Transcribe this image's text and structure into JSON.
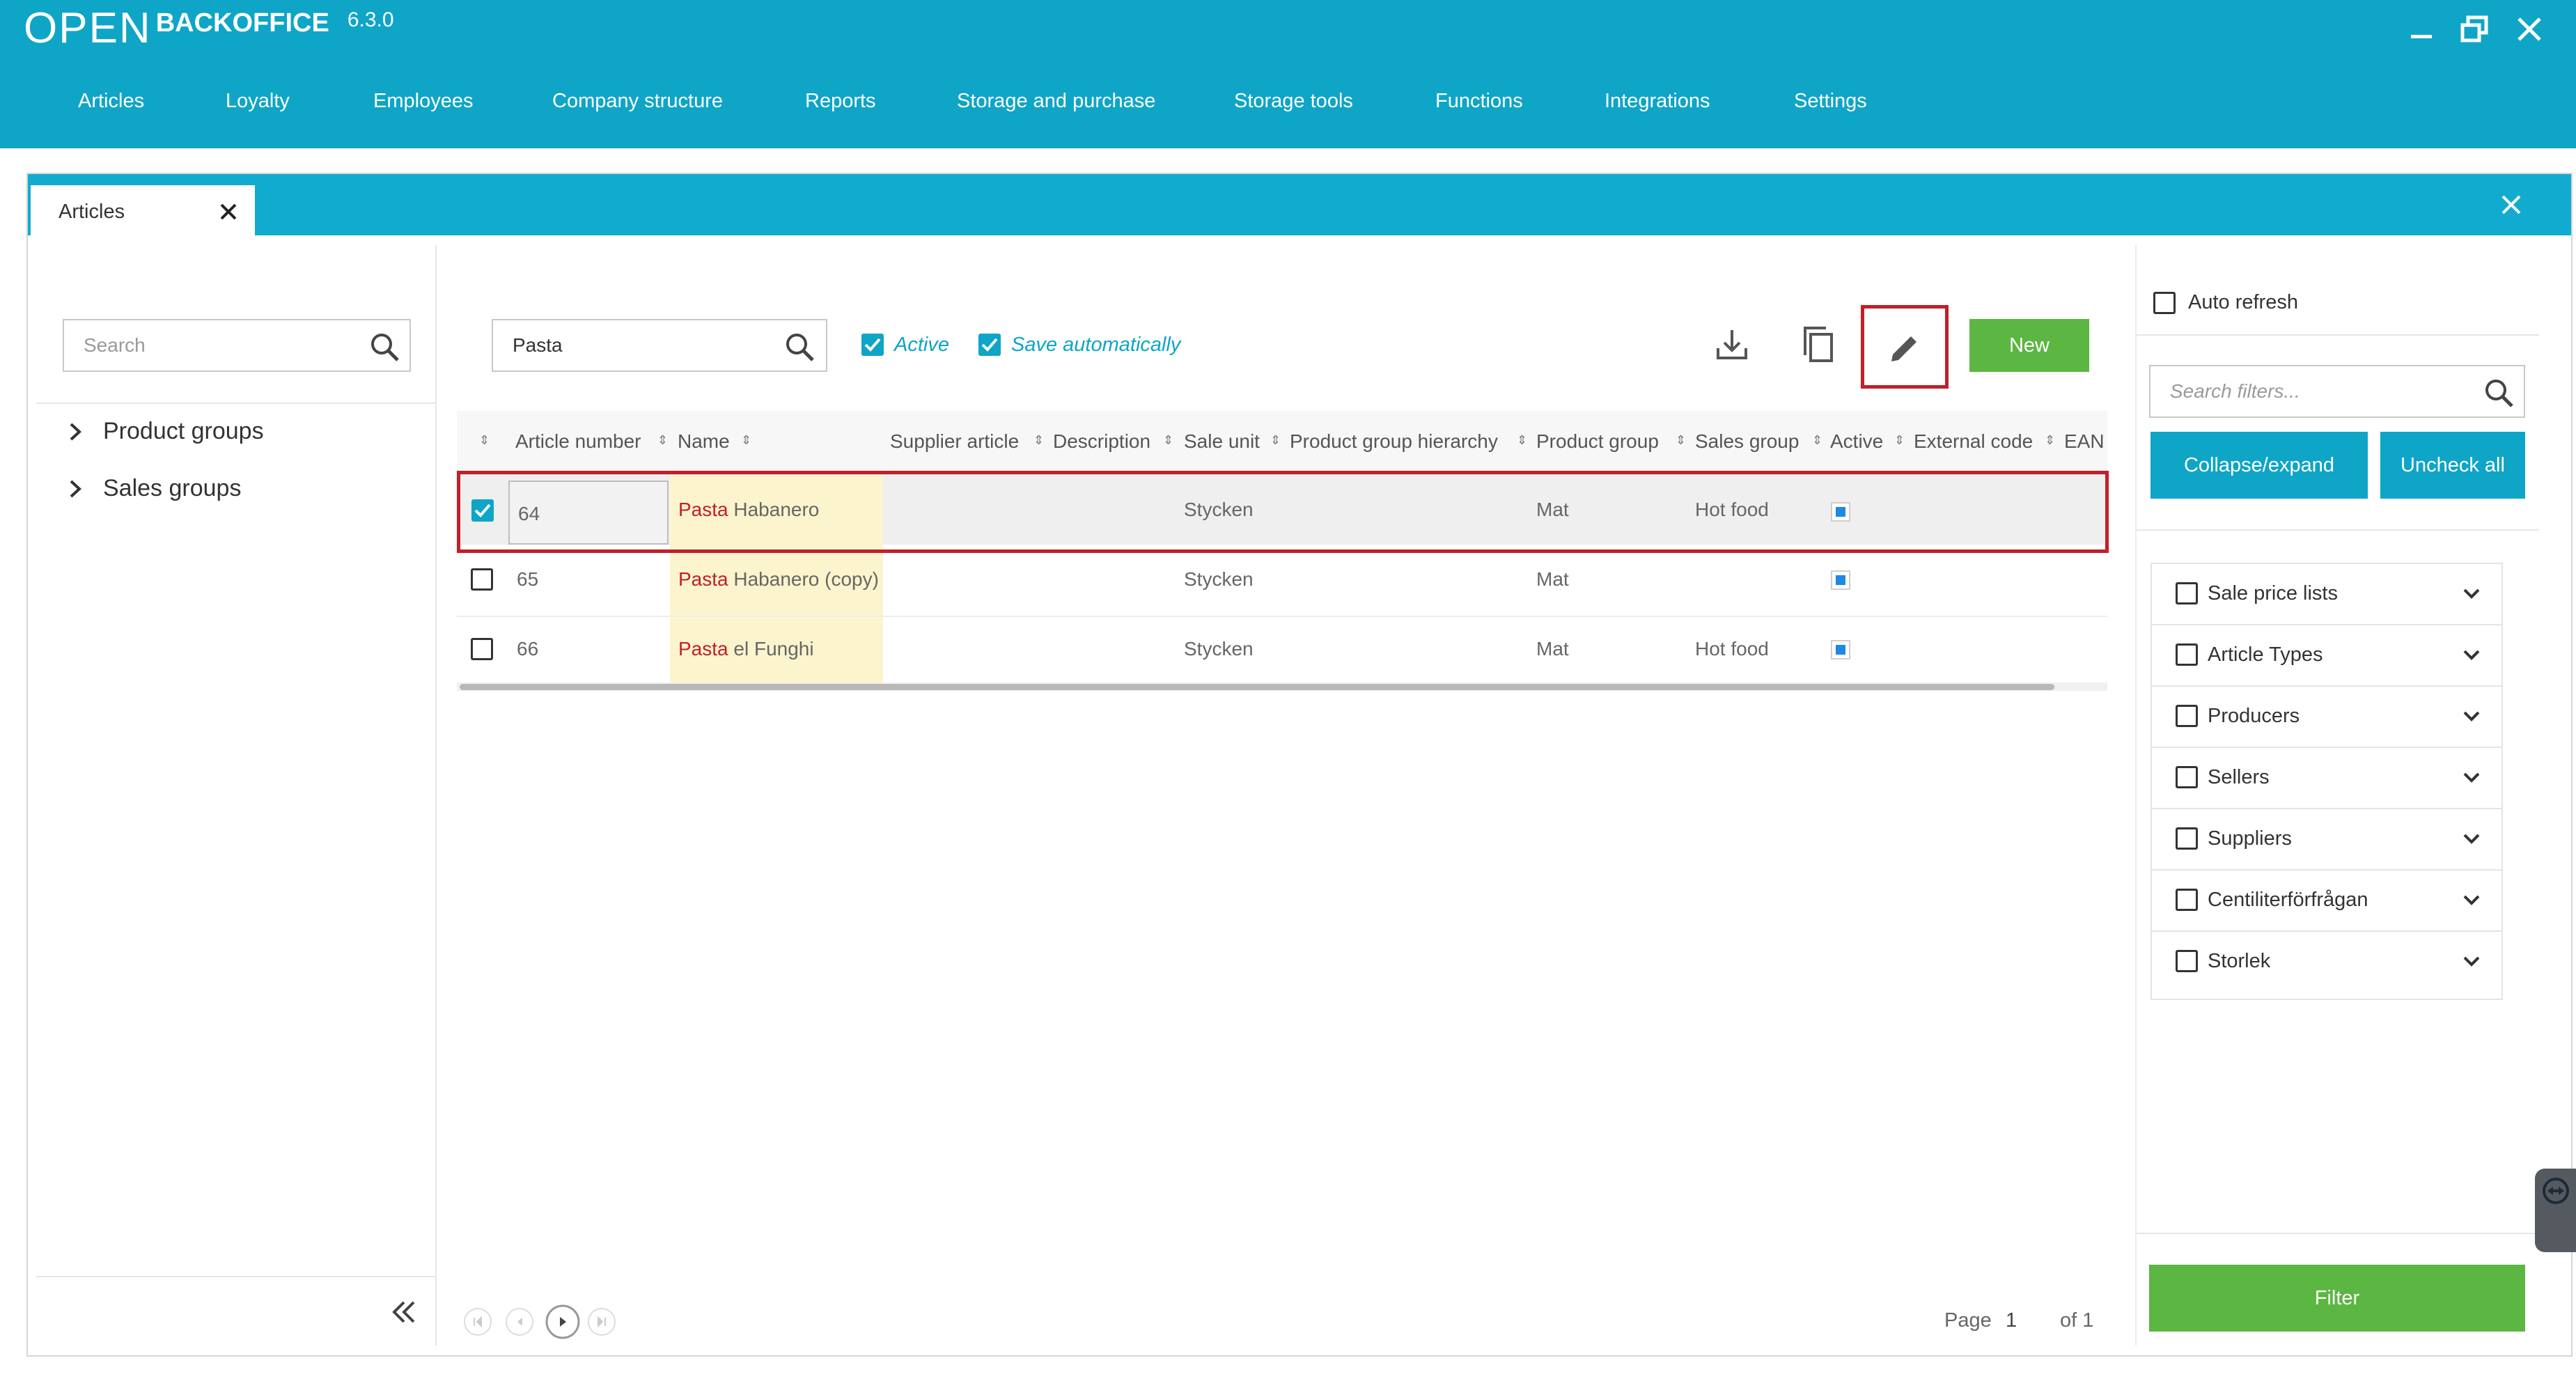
{
  "app": {
    "logo": "OPEN",
    "name": "BACKOFFICE",
    "version": "6.3.0"
  },
  "menu": [
    "Articles",
    "Loyalty",
    "Employees",
    "Company structure",
    "Reports",
    "Storage and purchase",
    "Storage tools",
    "Functions",
    "Integrations",
    "Settings"
  ],
  "tab": {
    "label": "Articles"
  },
  "left": {
    "search_placeholder": "Search",
    "tree": [
      "Product groups",
      "Sales groups"
    ]
  },
  "toolbar": {
    "search_value": "Pasta",
    "active_label": "Active",
    "save_auto_label": "Save automatically",
    "new_label": "New"
  },
  "table": {
    "headers": [
      "Article number",
      "Name",
      "Supplier article",
      "Description",
      "Sale unit",
      "Product group hierarchy",
      "Product group",
      "Sales group",
      "Active",
      "External code",
      "EAN"
    ],
    "rows": [
      {
        "checked": true,
        "number": "64",
        "highlight": "Pasta",
        "rest": " Habanero",
        "sale_unit": "Stycken",
        "product_group": "Mat",
        "sales_group": "Hot food"
      },
      {
        "checked": false,
        "number": "65",
        "highlight": "Pasta",
        "rest": " Habanero (copy)",
        "sale_unit": "Stycken",
        "product_group": "Mat",
        "sales_group": ""
      },
      {
        "checked": false,
        "number": "66",
        "highlight": "Pasta",
        "rest": " el Funghi",
        "sale_unit": "Stycken",
        "product_group": "Mat",
        "sales_group": "Hot food"
      }
    ]
  },
  "pager": {
    "page_label": "Page",
    "page": "1",
    "of_label": "of 1"
  },
  "right": {
    "auto_refresh": "Auto refresh",
    "search_placeholder": "Search filters...",
    "collapse_label": "Collapse/expand",
    "uncheck_label": "Uncheck all",
    "filters": [
      "Sale price lists",
      "Article Types",
      "Producers",
      "Sellers",
      "Suppliers",
      "Centiliterförfrågan",
      "Storlek"
    ],
    "filter_button": "Filter"
  },
  "colors": {
    "accent": "#0ea5c7",
    "green": "#5cb642",
    "highlight_red": "#c0202a",
    "match_bg": "#fbf4cc"
  }
}
